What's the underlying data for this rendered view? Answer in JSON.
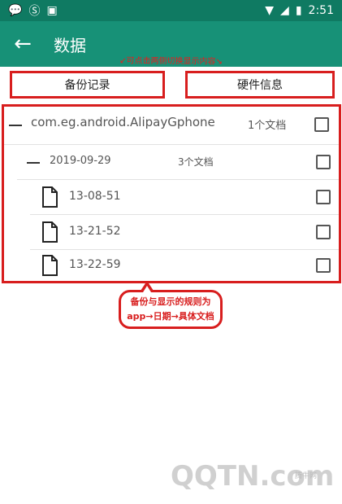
{
  "status_bar": {
    "time": "2:51"
  },
  "app_bar": {
    "title": "数据"
  },
  "annotation": {
    "top_hint": "↙可点击两侧切换显示内容↘"
  },
  "tabs": [
    {
      "label": "备份记录"
    },
    {
      "label": "硬件信息"
    }
  ],
  "tree": {
    "app": {
      "name": "com.eg.android.AlipayGphone",
      "count": "1个文档"
    },
    "date": {
      "name": "2019-09-29",
      "count": "3个文档"
    },
    "files": [
      "13-08-51",
      "13-21-52",
      "13-22-59"
    ]
  },
  "callout": {
    "line1": "备份与显示的规则为",
    "line2": "app→日期→具体文档"
  },
  "watermark": {
    "brand": "QQTN.com",
    "label": "腾牛网"
  },
  "colors": {
    "primary": "#179177",
    "status": "#0f7a62",
    "annotation": "#d81e1e"
  }
}
